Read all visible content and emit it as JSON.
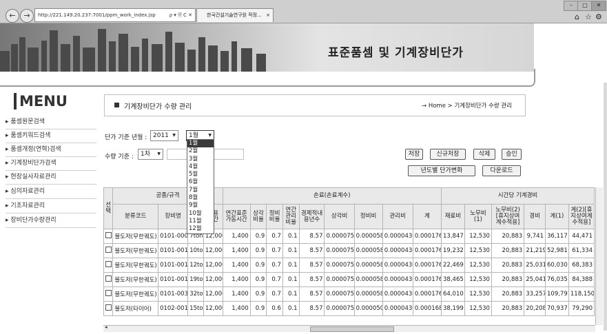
{
  "browser": {
    "url": "http://221.149.20.237:7001/ppm_work_index.jsp",
    "url_tools": "ρ ▾ 🗎 C ✕",
    "tab_title": "한국건설기술연구원 적정...",
    "tab_close": "×"
  },
  "banner": {
    "title": "표준품셈 및 기계장비단가"
  },
  "sidebar": {
    "title": "MENU",
    "items": [
      {
        "label": "품셈원문검색"
      },
      {
        "label": "품셈키워드검색"
      },
      {
        "label": "품셈개정(연혁)검색"
      },
      {
        "label": "기계장비단가검색"
      },
      {
        "label": "현장실사자료관리"
      },
      {
        "label": "심의자료관리"
      },
      {
        "label": "기초자료관리"
      },
      {
        "label": "장비단가수량관리"
      }
    ]
  },
  "page": {
    "title": "기계장비단가 수량 관리",
    "breadcrumb": "→ Home > 기계장비단가 수량 관리"
  },
  "filters": {
    "period_label": "단가 기준 년월 :",
    "year": "2011",
    "month": "1월",
    "qty_label": "수량 기준 :",
    "qty": "1차"
  },
  "buttons": {
    "save": "저장",
    "new_save": "신규저장",
    "delete": "삭제",
    "approve": "승인",
    "yearly": "년도별 단가변화",
    "download": "다운로드"
  },
  "month_options": [
    "1월",
    "2월",
    "3월",
    "4월",
    "5월",
    "6월",
    "7월",
    "8월",
    "9월",
    "10월",
    "11월",
    "12월"
  ],
  "table": {
    "groups": {
      "select": "선택",
      "spec": "공종/규격",
      "loss": "손료(손료계수)",
      "hourly": "시간당 기계경비"
    },
    "headers": [
      "분류코드",
      "장비명",
      "",
      "적용시간",
      "연간표준가동시간",
      "상각비율",
      "정비비율",
      "연간관리비율",
      "경제적내용년수",
      "상각비",
      "정비비",
      "관리비",
      "계",
      "재료비",
      "노무비(1)",
      "노무비(2)[휴지상여계수적용]",
      "경비",
      "계(1)",
      "계(2)[휴지상여계수적용]"
    ],
    "rows": [
      [
        "불도저(무한궤도)",
        "0101-0007",
        "7ton",
        "12,000",
        "1,400",
        "0.9",
        "0.7",
        "0.1",
        "8.57",
        "0.0000750",
        "0.0000583",
        "0.0000430",
        "0.0001763",
        "13,847",
        "12,530",
        "20,883",
        "9,741",
        "36,117",
        "44,471"
      ],
      [
        "불도저(무한궤도)",
        "0101-0010",
        "10ton",
        "12,000",
        "1,400",
        "0.9",
        "0.7",
        "0.1",
        "8.57",
        "0.0000750",
        "0.0000583",
        "0.0000430",
        "0.0001763",
        "19,232",
        "12,530",
        "20,883",
        "21,219",
        "52,981",
        "61,334"
      ],
      [
        "불도저(무한궤도)",
        "0101-0012",
        "12ton",
        "12,000",
        "1,400",
        "0.9",
        "0.7",
        "0.1",
        "8.57",
        "0.0000750",
        "0.0000583",
        "0.0000430",
        "0.0001763",
        "22,469",
        "12,530",
        "20,883",
        "25,031",
        "60,030",
        "68,383"
      ],
      [
        "불도저(무한궤도)",
        "0101-0019",
        "19ton",
        "12,000",
        "1,400",
        "0.9",
        "0.7",
        "0.1",
        "8.57",
        "0.0000750",
        "0.0000583",
        "0.0000430",
        "0.0001763",
        "38,465",
        "12,530",
        "20,883",
        "25,041",
        "76,035",
        "84,388"
      ],
      [
        "불도저(무한궤도)",
        "0101-0032",
        "32ton",
        "12,000",
        "1,400",
        "0.9",
        "0.7",
        "0.1",
        "8.57",
        "0.0000750",
        "0.0000583",
        "0.0000430",
        "0.0001763",
        "64,010",
        "12,530",
        "20,883",
        "33,257",
        "109,797",
        "118,150"
      ],
      [
        "불도저(타이어)",
        "0102-0015",
        "15ton",
        "12,000",
        "1,400",
        "0.9",
        "0.6",
        "0.1",
        "8.57",
        "0.0000750",
        "0.0000500",
        "0.0000430",
        "0.0001680",
        "38,199",
        "12,530",
        "20,883",
        "20,208",
        "70,937",
        "79,290"
      ]
    ]
  }
}
